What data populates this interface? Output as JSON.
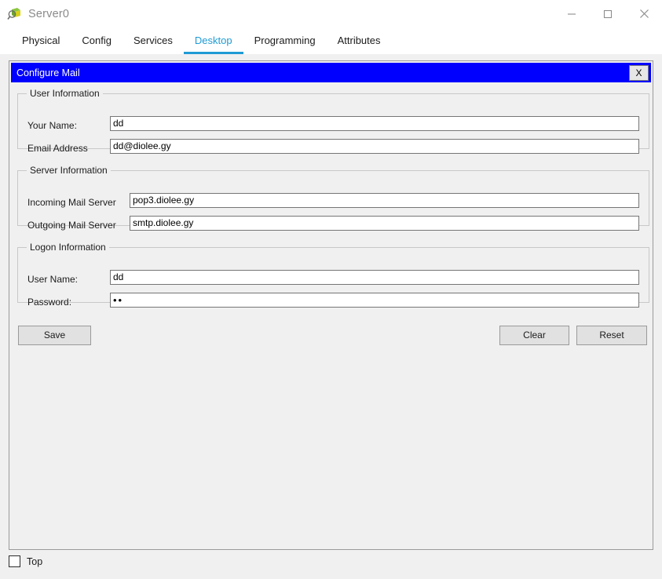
{
  "window": {
    "title": "Server0",
    "icon": "packet-tracer-icon",
    "controls": {
      "minimize": "minimize-icon",
      "maximize": "maximize-icon",
      "close": "close-icon"
    }
  },
  "tabs": [
    {
      "label": "Physical",
      "active": false
    },
    {
      "label": "Config",
      "active": false
    },
    {
      "label": "Services",
      "active": false
    },
    {
      "label": "Desktop",
      "active": true
    },
    {
      "label": "Programming",
      "active": false
    },
    {
      "label": "Attributes",
      "active": false
    }
  ],
  "colors": {
    "accent": "#1f9bd5",
    "dialog_header": "#0000ff",
    "panel_bg": "#f0f0f0",
    "input_bg": "#ffffff"
  },
  "dialog": {
    "title": "Configure Mail",
    "close_label": "X",
    "groups": {
      "user_information": {
        "legend": "User Information",
        "fields": [
          {
            "label": "Your Name:",
            "value": "dd",
            "placeholder": ""
          },
          {
            "label": "Email Address",
            "value": "dd@diolee.gy",
            "placeholder": ""
          }
        ]
      },
      "server_information": {
        "legend": "Server Information",
        "fields": [
          {
            "label": "Incoming Mail Server",
            "value": "pop3.diolee.gy",
            "placeholder": ""
          },
          {
            "label": "Outgoing Mail Server",
            "value": "smtp.diolee.gy",
            "placeholder": ""
          }
        ]
      },
      "logon_information": {
        "legend": "Logon Information",
        "fields": [
          {
            "label": "User Name:",
            "value": "dd",
            "placeholder": ""
          },
          {
            "label": "Password:",
            "value": "••",
            "placeholder": ""
          }
        ]
      }
    },
    "buttons": {
      "save": "Save",
      "clear": "Clear",
      "reset": "Reset"
    }
  },
  "footer": {
    "top_checkbox_label": "Top",
    "top_checkbox_checked": false
  }
}
